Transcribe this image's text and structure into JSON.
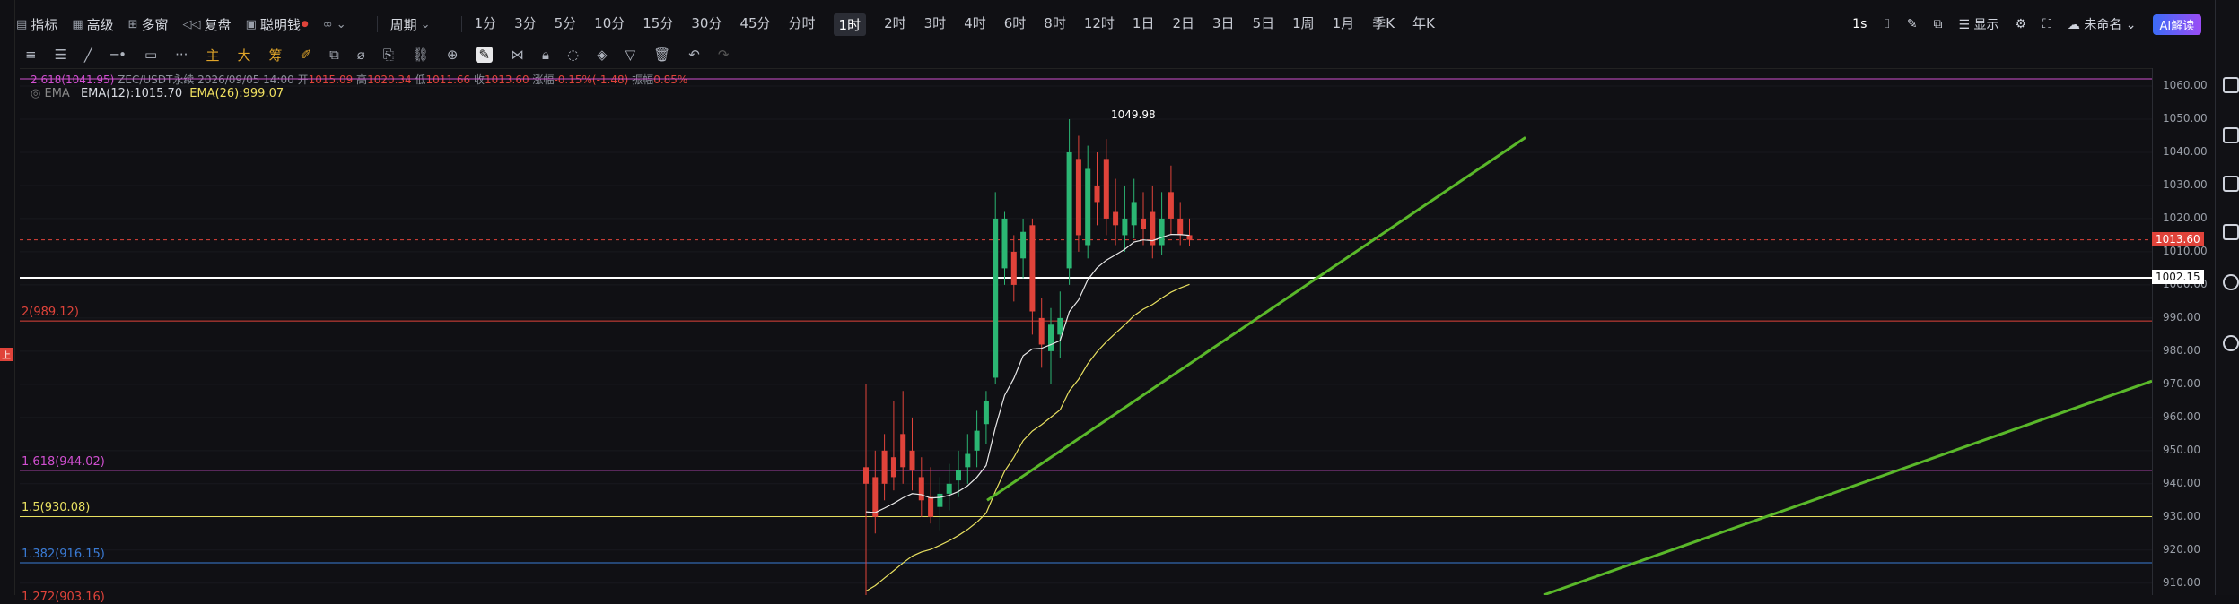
{
  "toolbar": {
    "left_items": [
      {
        "label": "指标",
        "icon": "indicator-icon"
      },
      {
        "label": "高级",
        "icon": "advanced-icon"
      },
      {
        "label": "多窗",
        "icon": "multi-window-icon"
      },
      {
        "label": "复盘",
        "icon": "replay-icon"
      },
      {
        "label": "聪明钱",
        "icon": "smart-money-icon"
      }
    ],
    "period_label": "周期",
    "periods": [
      "1分",
      "3分",
      "5分",
      "10分",
      "15分",
      "30分",
      "45分",
      "分时",
      "1时",
      "2时",
      "3时",
      "4时",
      "6时",
      "8时",
      "12时",
      "1日",
      "2日",
      "3日",
      "5日",
      "1周",
      "1月",
      "季K",
      "年K"
    ],
    "active_period": "1时",
    "right": {
      "interval": "1s",
      "display_label": "显示",
      "layout_name": "未命名",
      "ai_label": "AI解读"
    }
  },
  "drawing_tools": {
    "labels": [
      "主",
      "大",
      "筹"
    ]
  },
  "legend": {
    "top_line_prefix": "2.618(1041.95)",
    "symbol_line": "ZEC/USDT永续 2026/09/05 14:00",
    "open_label": "开",
    "open": "1015.09",
    "high_label": "高",
    "high": "1020.34",
    "low_label": "低",
    "low": "1011.66",
    "close_label": "收",
    "close": "1013.60",
    "change_label": "涨幅",
    "change": "-0.15%(-1.48)",
    "amp_label": "振幅",
    "amp": "0.85%",
    "ema_title": "EMA",
    "ema12": "EMA(12):1015.70",
    "ema26": "EMA(26):999.07"
  },
  "fib_levels": [
    {
      "label": "2(989.12)",
      "value": 989.12,
      "color": "#e0433a"
    },
    {
      "label": "1.618(944.02)",
      "value": 944.02,
      "color": "#d04fd0"
    },
    {
      "label": "1.5(930.08)",
      "value": 930.08,
      "color": "#e8e060"
    },
    {
      "label": "1.382(916.15)",
      "value": 916.15,
      "color": "#3a7bd5"
    },
    {
      "label": "1.272(903.16)",
      "value": 903.16,
      "color": "#e0433a"
    }
  ],
  "price_axis": {
    "ticks": [
      "1060.00",
      "1050.00",
      "1040.00",
      "1030.00",
      "1020.00",
      "1010.00",
      "1000.00",
      "990.00",
      "980.00",
      "970.00",
      "960.00",
      "950.00",
      "940.00",
      "930.00",
      "920.00",
      "910.00"
    ],
    "current_price": "1013.60",
    "hline_price": "1002.15"
  },
  "high_marker": "1049.98",
  "chart_data": {
    "type": "candlestick",
    "ylim": [
      905,
      1062
    ],
    "candles": [
      [
        945,
        940,
        970,
        905
      ],
      [
        942,
        930,
        950,
        925
      ],
      [
        950,
        940,
        955,
        935
      ],
      [
        948,
        942,
        965,
        938
      ],
      [
        955,
        945,
        968,
        940
      ],
      [
        950,
        944,
        960,
        938
      ],
      [
        942,
        935,
        948,
        930
      ],
      [
        936,
        930,
        945,
        928
      ],
      [
        933,
        937,
        942,
        926
      ],
      [
        937,
        940,
        946,
        932
      ],
      [
        941,
        944,
        950,
        936
      ],
      [
        945,
        949,
        955,
        940
      ],
      [
        950,
        956,
        962,
        945
      ],
      [
        958,
        965,
        968,
        952
      ],
      [
        972,
        1020,
        1028,
        970
      ],
      [
        1005,
        1020,
        1022,
        1000
      ],
      [
        1010,
        1000,
        1015,
        995
      ],
      [
        1008,
        1016,
        1020,
        1002
      ],
      [
        1018,
        992,
        1020,
        985
      ],
      [
        990,
        982,
        996,
        975
      ],
      [
        980,
        988,
        993,
        970
      ],
      [
        985,
        990,
        998,
        978
      ],
      [
        1005,
        1040,
        1050,
        1000
      ],
      [
        1038,
        1015,
        1045,
        1010
      ],
      [
        1012,
        1035,
        1042,
        1008
      ],
      [
        1030,
        1025,
        1040,
        1018
      ],
      [
        1038,
        1020,
        1044,
        1015
      ],
      [
        1022,
        1018,
        1032,
        1012
      ],
      [
        1015,
        1020,
        1030,
        1010
      ],
      [
        1018,
        1025,
        1032,
        1014
      ],
      [
        1020,
        1017,
        1028,
        1012
      ],
      [
        1022,
        1012,
        1030,
        1008
      ],
      [
        1012,
        1020,
        1028,
        1009
      ],
      [
        1028,
        1020,
        1036,
        1015
      ],
      [
        1020,
        1015,
        1025,
        1012
      ],
      [
        1015,
        1013.6,
        1020,
        1011.66
      ]
    ]
  }
}
